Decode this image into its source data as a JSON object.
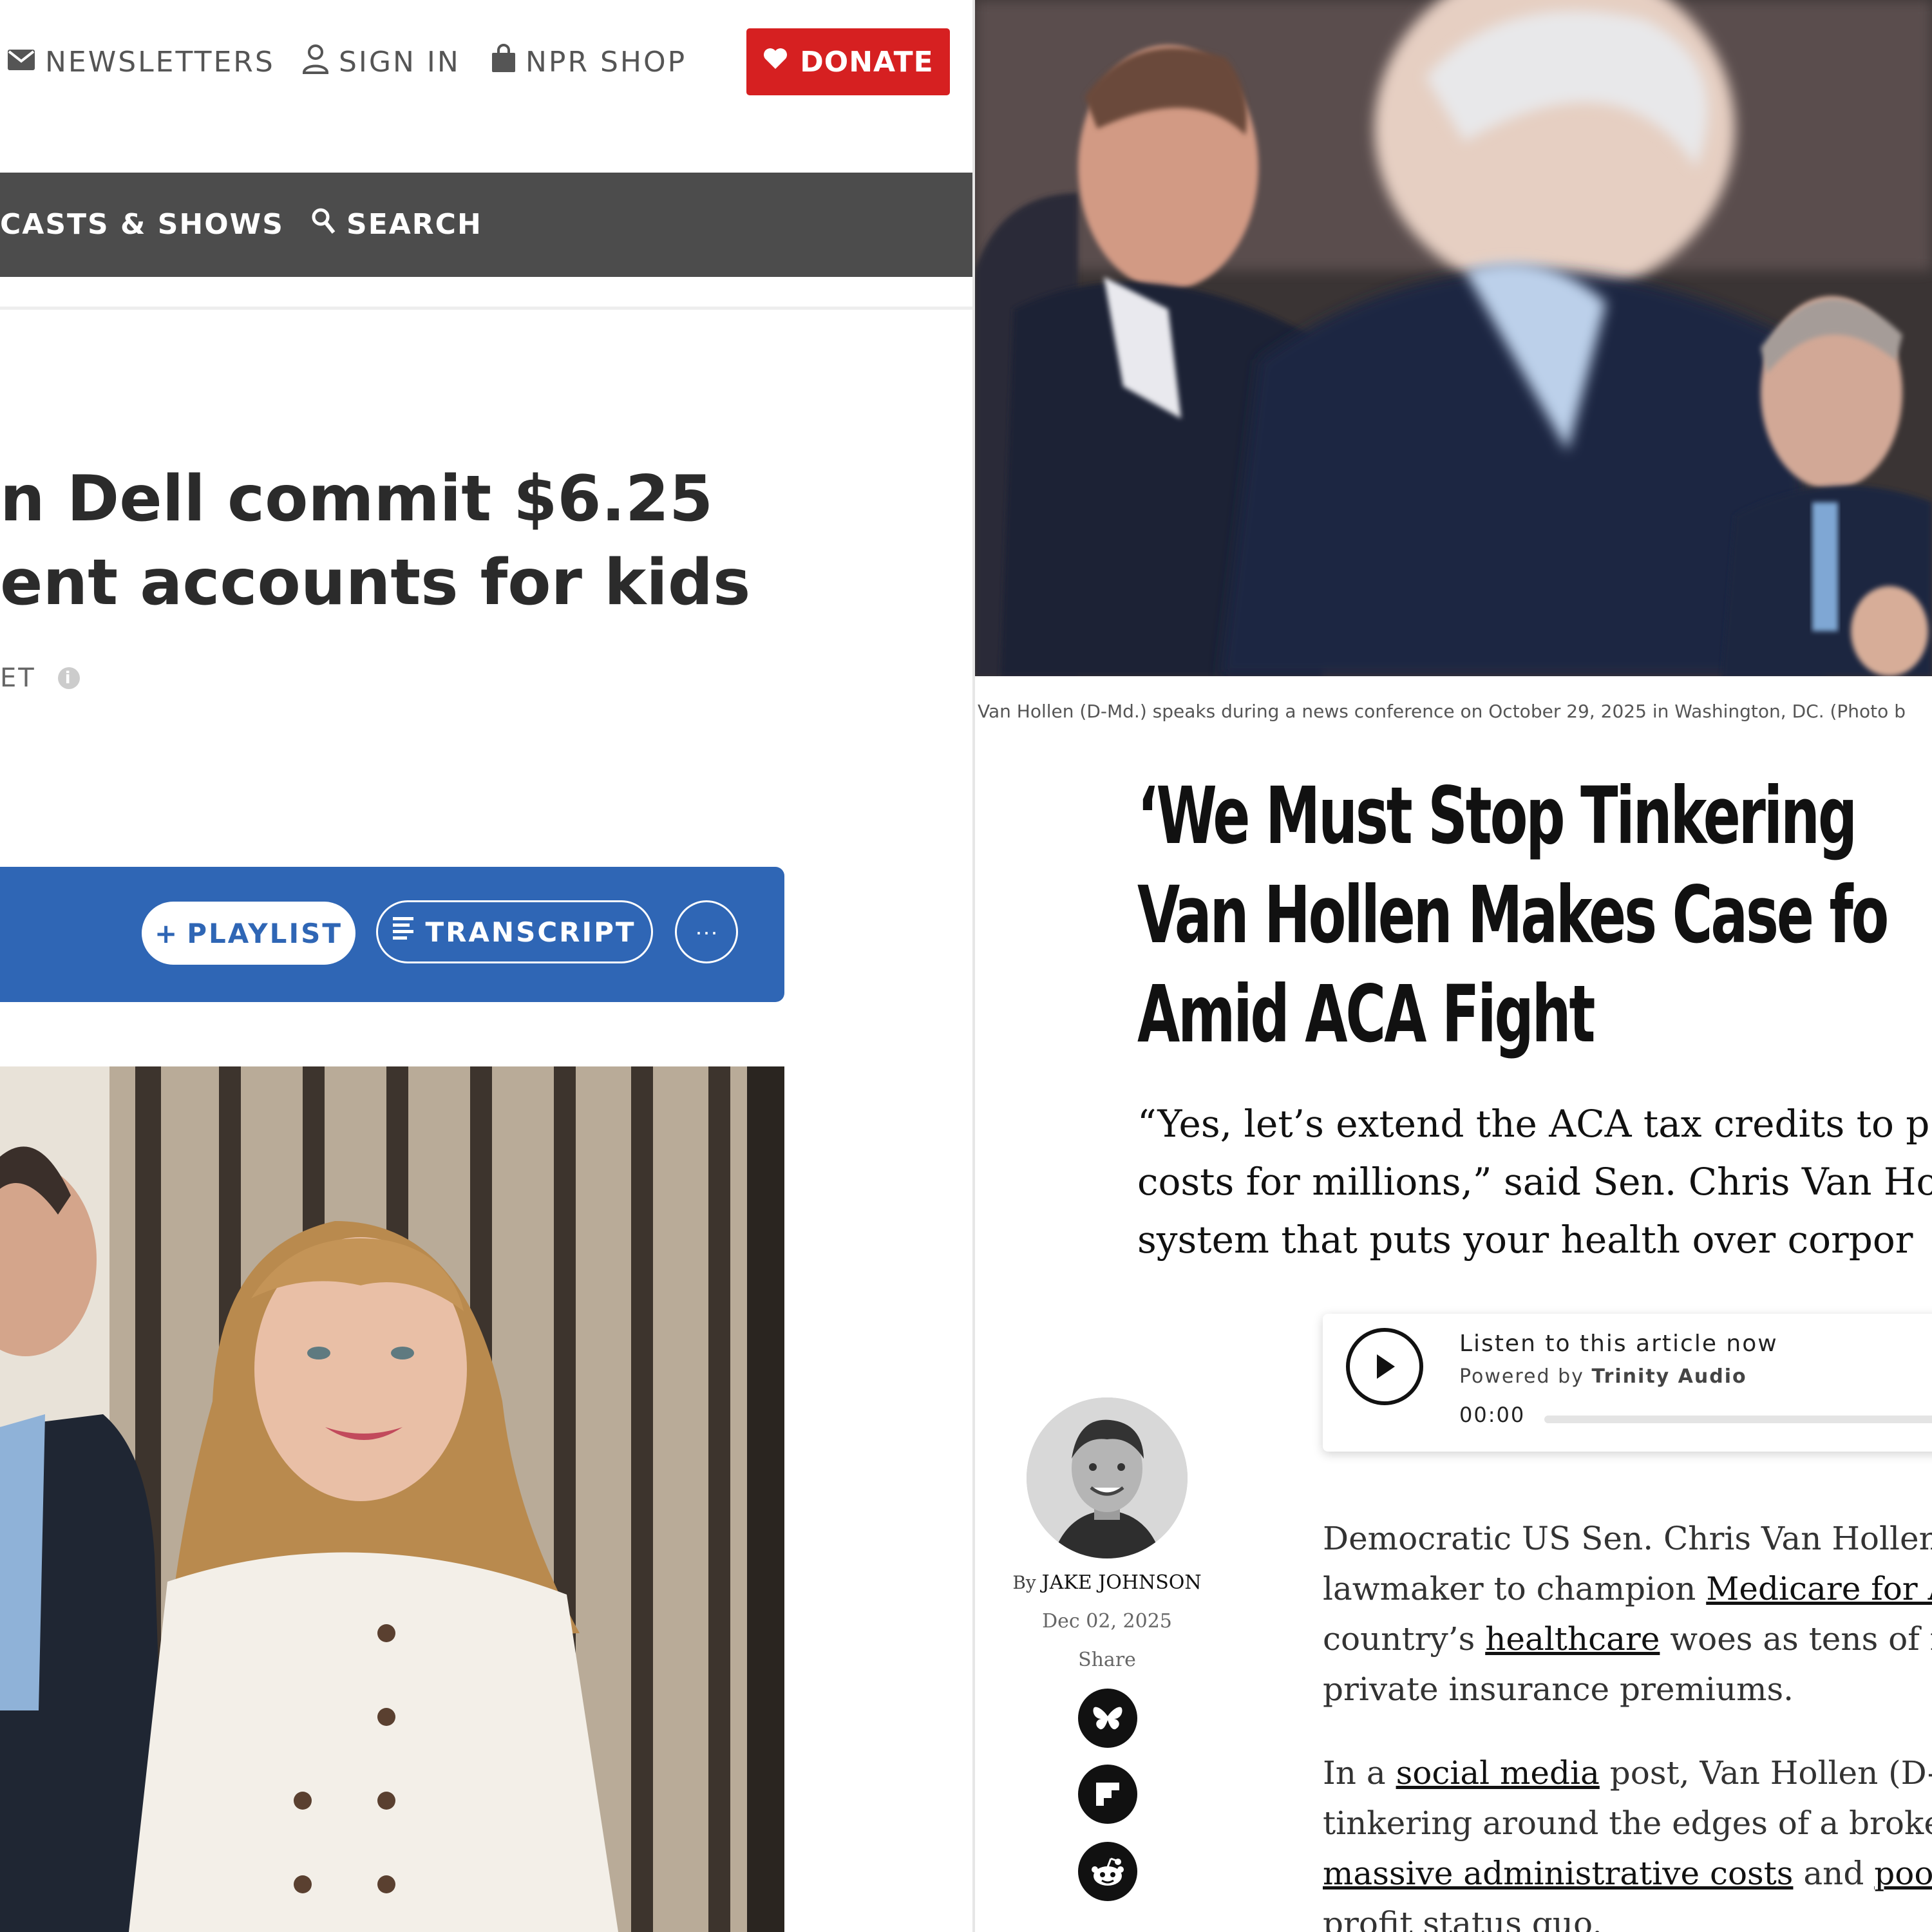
{
  "npr": {
    "utility_links": [
      {
        "label": "NEWSLETTERS",
        "icon": "envelope-icon"
      },
      {
        "label": "SIGN IN",
        "icon": "user-icon"
      },
      {
        "label": "NPR SHOP",
        "icon": "shopping-bag-icon"
      }
    ],
    "donate_label": "DONATE",
    "donate_color": "#d62021",
    "nav": {
      "podcasts_label": "CASTS & SHOWS",
      "search_label": "SEARCH",
      "background": "#4c4c4c"
    },
    "headline_lines": [
      "n Dell commit $6.25",
      "ent accounts for kids"
    ],
    "dateline": "ET",
    "audio_bar": {
      "playlist_label": "PLAYLIST",
      "transcript_label": "TRANSCRIPT",
      "more_label": "···",
      "color": "#2f66b5"
    }
  },
  "commondreams": {
    "caption": "Van Hollen (D-Md.) speaks during a news conference on October 29, 2025 in Washington, DC.   (Photo b",
    "headline_lines": [
      "‘We Must Stop Tinkering",
      "Van Hollen Makes Case fo",
      "Amid ACA Fight"
    ],
    "dek_lines": [
      "“Yes, let’s extend the ACA tax credits to p",
      "costs for millions,” said Sen. Chris Van Ho",
      "system that puts your health over corpor"
    ],
    "listen": {
      "title": "Listen to this article now",
      "powered_prefix": "Powered by",
      "powered_brand": "Trinity Audio",
      "time": "00:00",
      "progress": 0
    },
    "byline_prefix": "By",
    "author": "JAKE JOHNSON",
    "date": "Dec 02, 2025",
    "share_label": "Share",
    "share_icons": [
      "bluesky-icon",
      "flipboard-icon",
      "reddit-icon"
    ],
    "body": {
      "p1": {
        "l1": "Democratic US Sen. Chris Van Hollen or",
        "l2_pre": "lawmaker to champion ",
        "l2_link": "Medicare for All",
        "l3_pre": "country’s ",
        "l3_link": "healthcare",
        "l3_post": " woes as tens of mil",
        "l4": "private insurance premiums."
      },
      "p2": {
        "l1_pre": "In a ",
        "l1_link": "social media",
        "l1_post": " post, Van Hollen (D-Md",
        "l2": "tinkering around the edges of a broken h",
        "l3_link": "massive administrative costs",
        "l3_mid": " and ",
        "l3_link2": "poor h",
        "l4": "profit status quo."
      }
    }
  }
}
